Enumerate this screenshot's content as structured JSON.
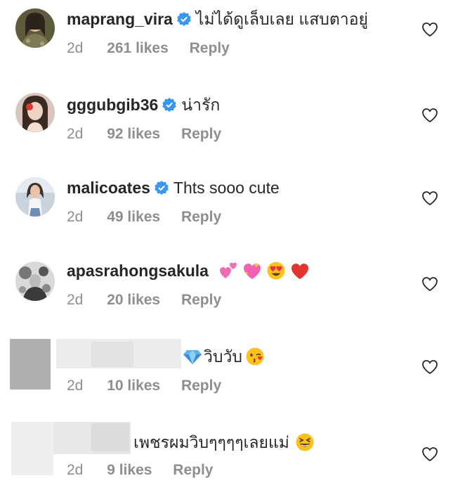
{
  "comments": [
    {
      "username": "maprang_vira",
      "verified": true,
      "text": "ไม่ได้ดูเล็บเลย แสบตาอยู่",
      "time": "2d",
      "likes": "261 likes",
      "reply": "Reply"
    },
    {
      "username": "gggubgib36",
      "verified": true,
      "text": "น่ารัก",
      "time": "2d",
      "likes": "92 likes",
      "reply": "Reply"
    },
    {
      "username": "malicoates",
      "verified": true,
      "text": "Thts sooo cute",
      "time": "2d",
      "likes": "49 likes",
      "reply": "Reply"
    },
    {
      "username": "apasrahongsakula",
      "verified": false,
      "text": "",
      "emojis": [
        "two-hearts",
        "sparkling-heart",
        "heart-eyes",
        "red-heart"
      ],
      "time": "2d",
      "likes": "20 likes",
      "reply": "Reply"
    },
    {
      "username": "",
      "verified": false,
      "text": "วิบวับ",
      "emojis_before": [
        "gem"
      ],
      "emojis_after": [
        "kissing-wink"
      ],
      "time": "2d",
      "likes": "10 likes",
      "reply": "Reply"
    },
    {
      "username": "",
      "verified": false,
      "text": "เพชรผมวิบๆๆๆๆเลยแม่",
      "emojis_after": [
        "grinning-squint"
      ],
      "time": "2d",
      "likes": "9 likes",
      "reply": "Reply"
    }
  ],
  "colors": {
    "text": "#262626",
    "meta": "#8e8e8e",
    "verified": "#3897f0"
  }
}
